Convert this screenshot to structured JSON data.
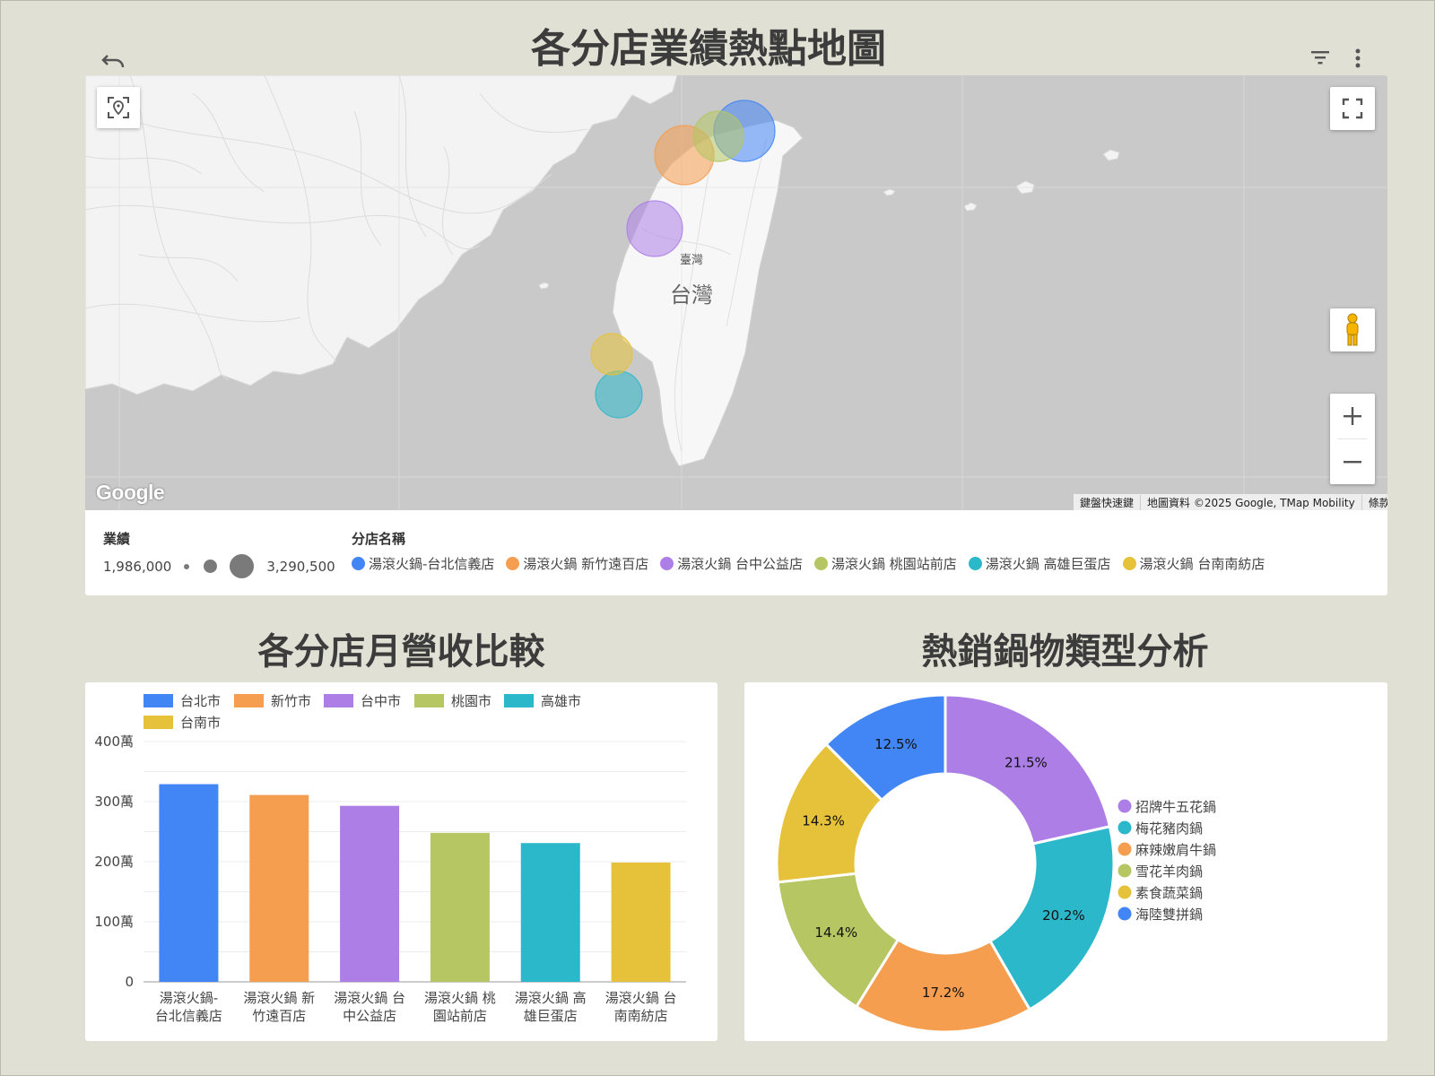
{
  "map_title": "各分店業績熱點地圖",
  "bar_title": "各分店月營收比較",
  "pie_title": "熱銷鍋物類型分析",
  "icons": {
    "undo": "undo-icon",
    "filter": "filter-icon",
    "more": "more-vert-icon",
    "locate": "location-target-icon",
    "fullscreen": "fullscreen-icon",
    "pegman": "pegman-icon",
    "zoom_in": "plus-icon",
    "zoom_out": "minus-icon"
  },
  "map": {
    "region_label_small": "臺灣",
    "region_label_large": "台灣",
    "google_logo": "Google",
    "attribution": {
      "shortcuts": "鍵盤快速鍵",
      "data": "地圖資料 ©2025 Google, TMap Mobility",
      "terms": "條款"
    },
    "bubbles": [
      {
        "store": "湯滾火鍋-台北信義店",
        "color": "#4285f4"
      },
      {
        "store": "湯滾火鍋 新竹遠百店",
        "color": "#f59e4f"
      },
      {
        "store": "湯滾火鍋 台中公益店",
        "color": "#ad7fe6"
      },
      {
        "store": "湯滾火鍋 桃園站前店",
        "color": "#b5c663"
      },
      {
        "store": "湯滾火鍋 高雄巨蛋店",
        "color": "#2bb8cb"
      },
      {
        "store": "湯滾火鍋 台南南紡店",
        "color": "#e6c23b"
      }
    ]
  },
  "map_legend": {
    "size_title": "業績",
    "size_min": "1,986,000",
    "size_max": "3,290,500",
    "color_title": "分店名稱",
    "items": [
      {
        "label": "湯滾火鍋-台北信義店",
        "color": "#4285f4"
      },
      {
        "label": "湯滾火鍋 新竹遠百店",
        "color": "#f59e4f"
      },
      {
        "label": "湯滾火鍋 台中公益店",
        "color": "#ad7fe6"
      },
      {
        "label": "湯滾火鍋 桃園站前店",
        "color": "#b5c663"
      },
      {
        "label": "湯滾火鍋 高雄巨蛋店",
        "color": "#2bb8cb"
      },
      {
        "label": "湯滾火鍋 台南南紡店",
        "color": "#e6c23b"
      }
    ]
  },
  "chart_data": [
    {
      "type": "bar",
      "title": "各分店月營收比較",
      "categories": [
        [
          "湯滾火鍋-",
          "台北信義店"
        ],
        [
          "湯滾火鍋 新",
          "竹遠百店"
        ],
        [
          "湯滾火鍋 台",
          "中公益店"
        ],
        [
          "湯滾火鍋 桃",
          "園站前店"
        ],
        [
          "湯滾火鍋 高",
          "雄巨蛋店"
        ],
        [
          "湯滾火鍋 台",
          "南南紡店"
        ]
      ],
      "legend": [
        "台北市",
        "新竹市",
        "台中市",
        "桃園市",
        "高雄市",
        "台南市"
      ],
      "legend_position": "top",
      "colors": [
        "#4285f4",
        "#f59e4f",
        "#ad7fe6",
        "#b5c663",
        "#2bb8cb",
        "#e6c23b"
      ],
      "values": [
        3290500,
        3110000,
        2930000,
        2480000,
        2310000,
        1986000
      ],
      "ylim": [
        0,
        4000000
      ],
      "yticks": [
        0,
        1000000,
        2000000,
        3000000,
        4000000
      ],
      "ytick_labels": [
        "0",
        "100萬",
        "200萬",
        "300萬",
        "400萬"
      ],
      "grid": true
    },
    {
      "type": "pie",
      "style": "donut",
      "title": "熱銷鍋物類型分析",
      "labels": [
        "招牌牛五花鍋",
        "梅花豬肉鍋",
        "麻辣嫩肩牛鍋",
        "雪花羊肉鍋",
        "素食蔬菜鍋",
        "海陸雙拼鍋"
      ],
      "values": [
        21.5,
        20.2,
        17.2,
        14.4,
        14.3,
        12.5
      ],
      "value_labels": [
        "21.5%",
        "20.2%",
        "17.2%",
        "14.4%",
        "14.3%",
        "12.5%"
      ],
      "colors": [
        "#ad7fe6",
        "#2bb8cb",
        "#f59e4f",
        "#b5c663",
        "#e6c23b",
        "#4285f4"
      ],
      "legend_position": "right"
    }
  ]
}
